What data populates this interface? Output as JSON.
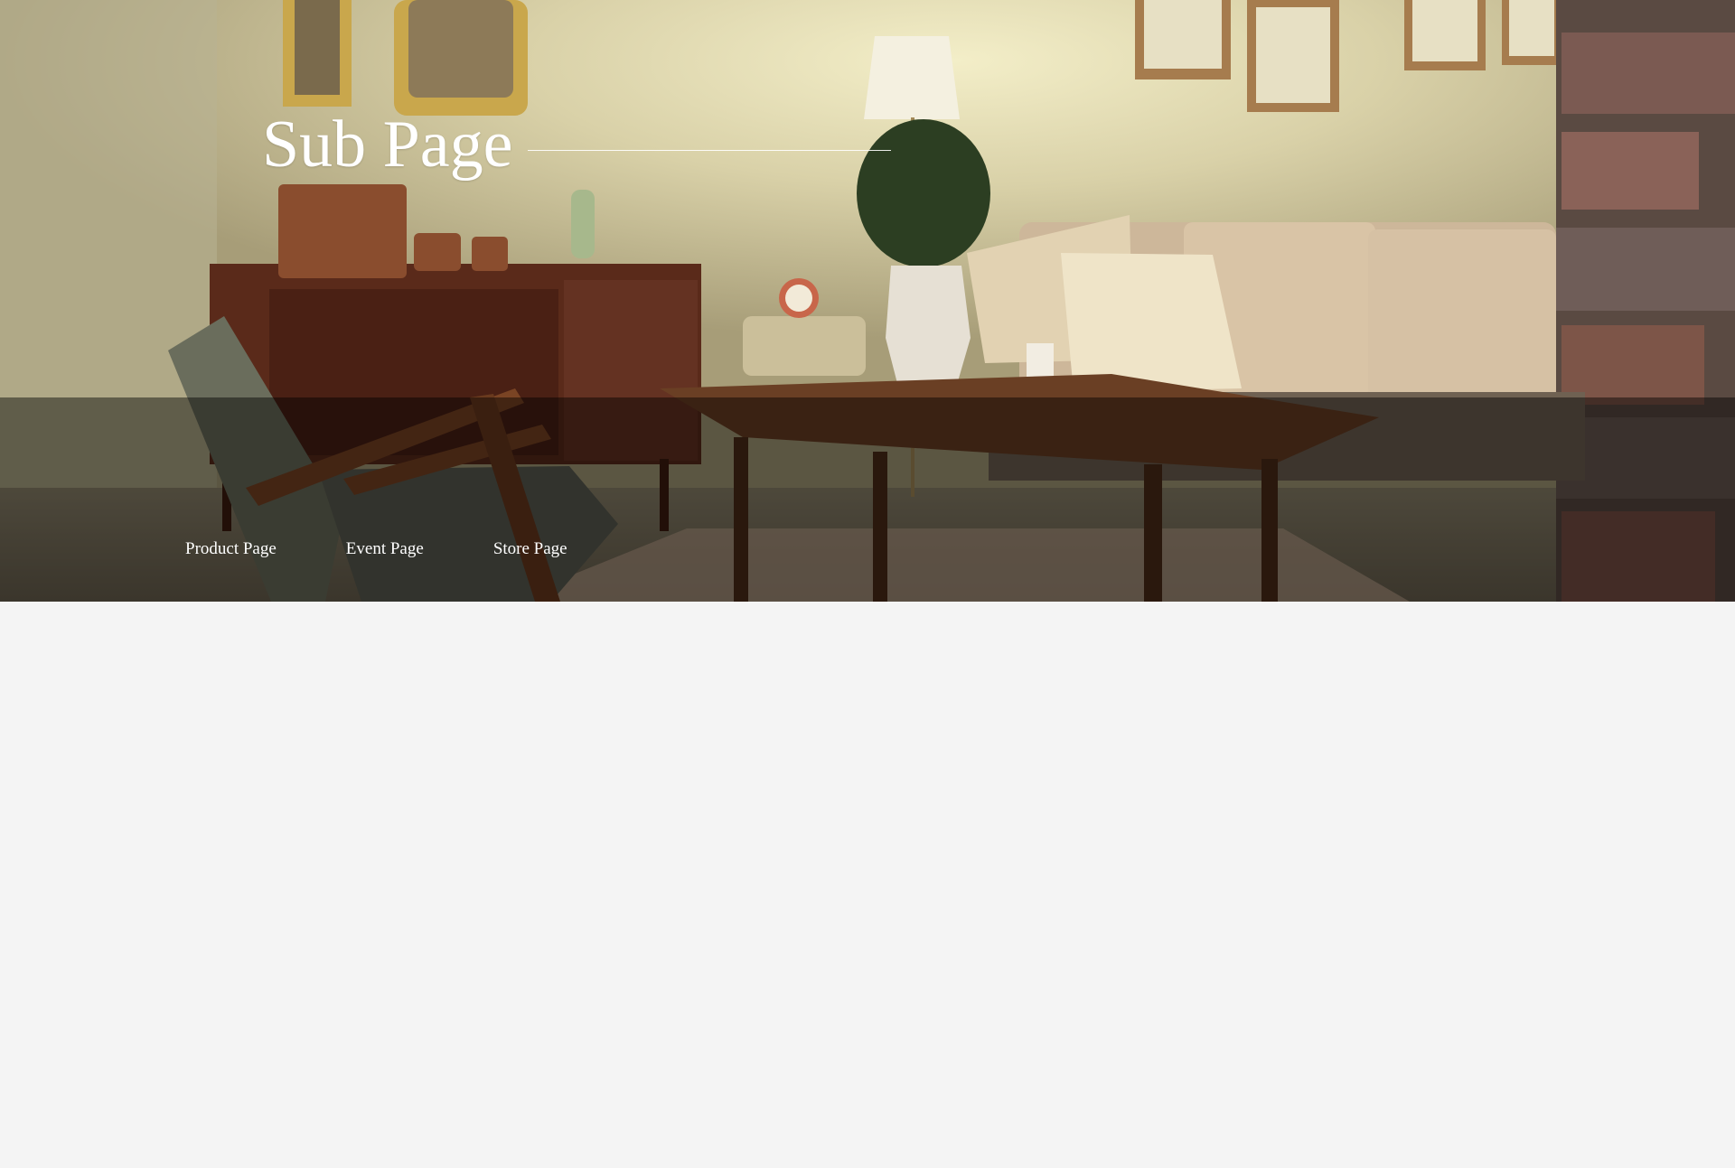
{
  "hero": {
    "title": "Sub Page",
    "image_alt": "Vintage living room with wooden sideboard, armchair, sofa, coffee table and floor lamp"
  },
  "nav": {
    "items": [
      {
        "label": "Product Page"
      },
      {
        "label": "Event Page"
      },
      {
        "label": "Store Page"
      }
    ]
  },
  "colors": {
    "page_background": "#f4f4f4",
    "title_text": "#ffffff",
    "nav_overlay": "rgba(0,0,0,0.45)"
  }
}
